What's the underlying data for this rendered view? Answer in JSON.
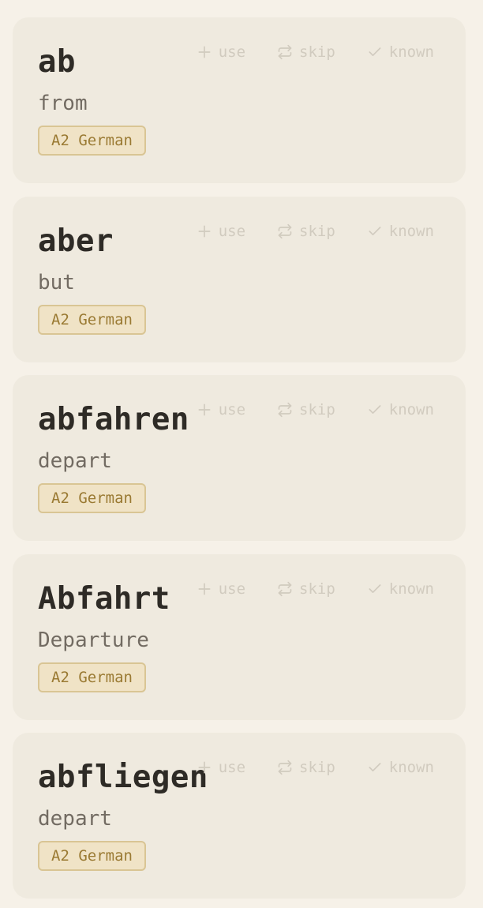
{
  "actions": {
    "use_label": "use",
    "skip_label": "skip",
    "known_label": "known",
    "use_icon": "plus-icon",
    "skip_icon": "repeat-icon",
    "known_icon": "check-icon"
  },
  "colors": {
    "background": "#f6f1e8",
    "card": "#efeadf",
    "word": "#2e2b26",
    "translation": "#726b62",
    "badge_bg": "#f0e3c6",
    "badge_border": "#d9c594",
    "badge_text": "#9a7a33",
    "action": "#d1cbbf"
  },
  "cards": [
    {
      "word": "ab",
      "translation": "from",
      "tag": "A2 German"
    },
    {
      "word": "aber",
      "translation": "but",
      "tag": "A2 German"
    },
    {
      "word": "abfahren",
      "translation": "depart",
      "tag": "A2 German"
    },
    {
      "word": "Abfahrt",
      "translation": "Departure",
      "tag": "A2 German"
    },
    {
      "word": "abfliegen",
      "translation": "depart",
      "tag": "A2 German"
    }
  ]
}
